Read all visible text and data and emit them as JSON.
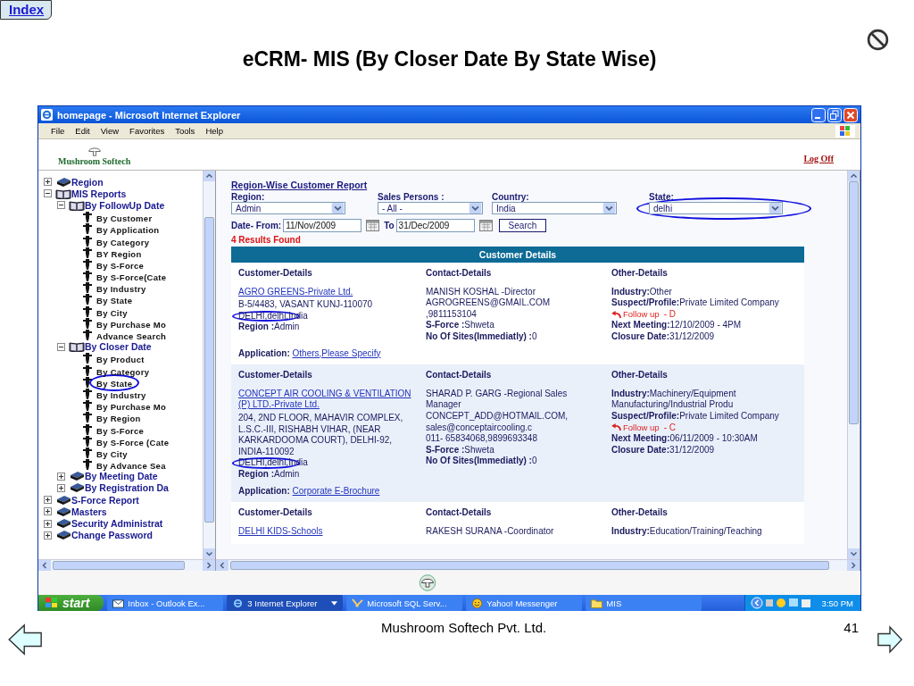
{
  "slide": {
    "index_link": "Index",
    "title": "eCRM- MIS (By Closer Date By State Wise)",
    "footer": "Mushroom Softech Pvt. Ltd.",
    "page_number": "41"
  },
  "window": {
    "title": "homepage - Microsoft Internet Explorer"
  },
  "menu": [
    "File",
    "Edit",
    "View",
    "Favorites",
    "Tools",
    "Help"
  ],
  "header": {
    "logo": "Mushroom Softech",
    "logout": "Log Off"
  },
  "sidebar": {
    "items": [
      {
        "label": "Region",
        "expanded": false
      },
      {
        "label": "MIS Reports",
        "expanded": true,
        "children": [
          {
            "label": "By FollowUp Date",
            "expanded": true,
            "children": [
              {
                "label": "By Customer",
                "circled": false
              },
              {
                "label": "By Application",
                "circled": false
              },
              {
                "label": "By Category",
                "circled": false
              },
              {
                "label": "BY Region",
                "circled": false
              },
              {
                "label": "By S-Force",
                "circled": false
              },
              {
                "label": "By S-Force(Cate",
                "circled": false
              },
              {
                "label": "By Industry",
                "circled": false
              },
              {
                "label": "By State",
                "circled": false
              },
              {
                "label": "By City",
                "circled": false
              },
              {
                "label": "By Purchase Mo",
                "circled": false
              },
              {
                "label": "Advance Search",
                "circled": false
              }
            ]
          },
          {
            "label": "By Closer Date",
            "expanded": true,
            "children": [
              {
                "label": "By Product",
                "circled": false
              },
              {
                "label": "By Category",
                "circled": false
              },
              {
                "label": "By State",
                "circled": true
              },
              {
                "label": "By Industry",
                "circled": false
              },
              {
                "label": "By Purchase Mo",
                "circled": false
              },
              {
                "label": "By Region",
                "circled": false
              },
              {
                "label": "By S-Force",
                "circled": false
              },
              {
                "label": "By S-Force (Cate",
                "circled": false
              },
              {
                "label": "By City",
                "circled": false
              },
              {
                "label": "By Advance Sea",
                "circled": false
              }
            ]
          },
          {
            "label": "By Meeting Date",
            "expanded": false
          },
          {
            "label": "By Registration Da",
            "expanded": false
          }
        ]
      },
      {
        "label": "S-Force Report",
        "expanded": false
      },
      {
        "label": "Masters",
        "expanded": false
      },
      {
        "label": "Security Administrat",
        "expanded": false
      },
      {
        "label": "Change Password",
        "expanded": false
      }
    ]
  },
  "report": {
    "title": "Region-Wise Customer Report",
    "filters": [
      {
        "label": "Region:",
        "value": "Admin",
        "circled": false
      },
      {
        "label": "Sales Persons :",
        "value": "- All -",
        "circled": false
      },
      {
        "label": "Country:",
        "value": "India",
        "circled": false
      },
      {
        "label": "State:",
        "value": "delhi",
        "circled": true
      }
    ],
    "date_from_label": "Date- From:",
    "date_from": "11/Nov/2009",
    "date_to_label": "To",
    "date_to": "31/Dec/2009",
    "search": "Search",
    "results": "4 Results Found",
    "table_title": "Customer Details",
    "records": [
      {
        "headings": [
          "Customer-Details",
          "Contact-Details",
          "Other-Details"
        ],
        "name": "AGRO GREENS-Private Ltd.",
        "customer": [
          {
            "kind": "text",
            "value": "B-5/4483, VASANT KUNJ-110070",
            "circled": false
          },
          {
            "kind": "text",
            "value": "DELHI,delhi,India",
            "circled": true
          },
          {
            "kind": "field",
            "label": "Region :",
            "value": "Admin",
            "circled": false
          }
        ],
        "contact": [
          {
            "kind": "text",
            "value": "MANISH KOSHAL -Director"
          },
          {
            "kind": "text",
            "value": "AGROGREENS@GMAIL.COM"
          },
          {
            "kind": "text",
            "value": ",9811153104"
          },
          {
            "kind": "field",
            "label": "S-Force :",
            "value": "Shweta"
          },
          {
            "kind": "field",
            "label": "No Of Sites(Immediatly) :",
            "value": "0"
          }
        ],
        "other": [
          {
            "kind": "field",
            "label": "Industry:",
            "value": "Other"
          },
          {
            "kind": "field",
            "label": "Suspect/Profile:",
            "value": "Private Limited Company"
          },
          {
            "kind": "followup",
            "label": "Follow up",
            "value": "- D"
          },
          {
            "kind": "field",
            "label": "Next Meeting:",
            "value": "12/10/2009 - 4PM"
          },
          {
            "kind": "field",
            "label": "Closure Date:",
            "value": "31/12/2009"
          }
        ],
        "application_label": "Application:",
        "application": "Others,Please Specify"
      },
      {
        "headings": [
          "Customer-Details",
          "Contact-Details",
          "Other-Details"
        ],
        "name": "CONCEPT AIR COOLING & VENTILATION (P) LTD.-Private Ltd.",
        "customer": [
          {
            "kind": "text",
            "value": "204, 2ND FLOOR, MAHAVIR COMPLEX, L.S.C.-III, RISHABH VIHAR, (NEAR KARKARDOOMA COURT), DELHI-92, INDIA-110092",
            "circled": false
          },
          {
            "kind": "text",
            "value": "DELHI,delhi,India",
            "circled": true
          },
          {
            "kind": "field",
            "label": "Region :",
            "value": "Admin",
            "circled": false
          }
        ],
        "contact": [
          {
            "kind": "text",
            "value": "SHARAD P. GARG -Regional Sales Manager"
          },
          {
            "kind": "text",
            "value": "CONCEPT_ADD@HOTMAIL.COM,"
          },
          {
            "kind": "text",
            "value": "sales@conceptaircooling.c"
          },
          {
            "kind": "text",
            "value": "011- 65834068,9899693348"
          },
          {
            "kind": "field",
            "label": "S-Force :",
            "value": "Shweta"
          },
          {
            "kind": "field",
            "label": "No Of Sites(Immediatly) :",
            "value": "0"
          }
        ],
        "other": [
          {
            "kind": "field",
            "label": "Industry:",
            "value": "Machinery/Equipment Manufacturing/Industrial Produ"
          },
          {
            "kind": "field",
            "label": "Suspect/Profile:",
            "value": "Private Limited Company"
          },
          {
            "kind": "followup",
            "label": "Follow up",
            "value": "- C"
          },
          {
            "kind": "field",
            "label": "Next Meeting:",
            "value": "06/11/2009 - 10:30AM"
          },
          {
            "kind": "field",
            "label": "Closure Date:",
            "value": "31/12/2009"
          }
        ],
        "application_label": "Application:",
        "application": "Corporate E-Brochure"
      },
      {
        "headings": [
          "Customer-Details",
          "Contact-Details",
          "Other-Details"
        ],
        "name": "DELHI KIDS-Schools",
        "contact": [
          {
            "kind": "text",
            "value": "RAKESH SURANA -Coordinator"
          }
        ],
        "other": [
          {
            "kind": "field",
            "label": "Industry:",
            "value": "Education/Training/Teaching"
          }
        ]
      }
    ]
  },
  "taskbar": {
    "start": "start",
    "tasks": [
      {
        "kind": "mail",
        "label": "Inbox - Outlook Ex...",
        "selected": false
      },
      {
        "kind": "browser",
        "label": "3 Internet Explorer",
        "selected": true
      },
      {
        "kind": "database",
        "label": "Microsoft SQL Serv...",
        "selected": false
      },
      {
        "kind": "messenger",
        "label": "Yahoo! Messenger",
        "selected": false
      },
      {
        "kind": "folder",
        "label": "MIS",
        "selected": false
      }
    ],
    "clock": "3:50 PM"
  }
}
